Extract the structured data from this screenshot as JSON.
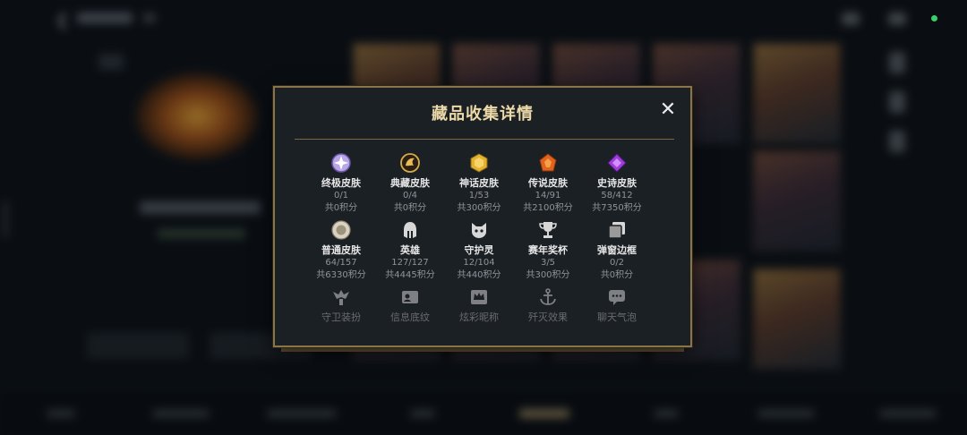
{
  "status": {
    "indicator_color": "#37d06a"
  },
  "colors": {
    "accent_gold": "#ecd9a8",
    "border_gold": "#8a7548"
  },
  "modal": {
    "title": "藏品收集详情",
    "close_icon": "close-icon",
    "rows": [
      [
        {
          "icon": "ultimate-skin-icon",
          "label": "终极皮肤",
          "count": "0/1",
          "points": "共0积分"
        },
        {
          "icon": "classic-skin-icon",
          "label": "典藏皮肤",
          "count": "0/4",
          "points": "共0积分"
        },
        {
          "icon": "mythic-skin-icon",
          "label": "神话皮肤",
          "count": "1/53",
          "points": "共300积分"
        },
        {
          "icon": "legendary-skin-icon",
          "label": "传说皮肤",
          "count": "14/91",
          "points": "共2100积分"
        },
        {
          "icon": "epic-skin-icon",
          "label": "史诗皮肤",
          "count": "58/412",
          "points": "共7350积分"
        }
      ],
      [
        {
          "icon": "normal-skin-icon",
          "label": "普通皮肤",
          "count": "64/157",
          "points": "共6330积分"
        },
        {
          "icon": "hero-helmet-icon",
          "label": "英雄",
          "count": "127/127",
          "points": "共4445积分"
        },
        {
          "icon": "guardian-spirit-icon",
          "label": "守护灵",
          "count": "12/104",
          "points": "共440积分"
        },
        {
          "icon": "trophy-icon",
          "label": "赛年奖杯",
          "count": "3/5",
          "points": "共300积分"
        },
        {
          "icon": "popup-frame-icon",
          "label": "弹窗边框",
          "count": "0/2",
          "points": "共0积分"
        }
      ],
      [
        {
          "icon": "guardian-outfit-icon",
          "label": "守卫装扮"
        },
        {
          "icon": "info-card-icon",
          "label": "信息底纹"
        },
        {
          "icon": "crown-title-icon",
          "label": "炫彩昵称"
        },
        {
          "icon": "anchor-effect-icon",
          "label": "歼灭效果"
        },
        {
          "icon": "chat-bubble-icon",
          "label": "聊天气泡"
        }
      ]
    ]
  }
}
